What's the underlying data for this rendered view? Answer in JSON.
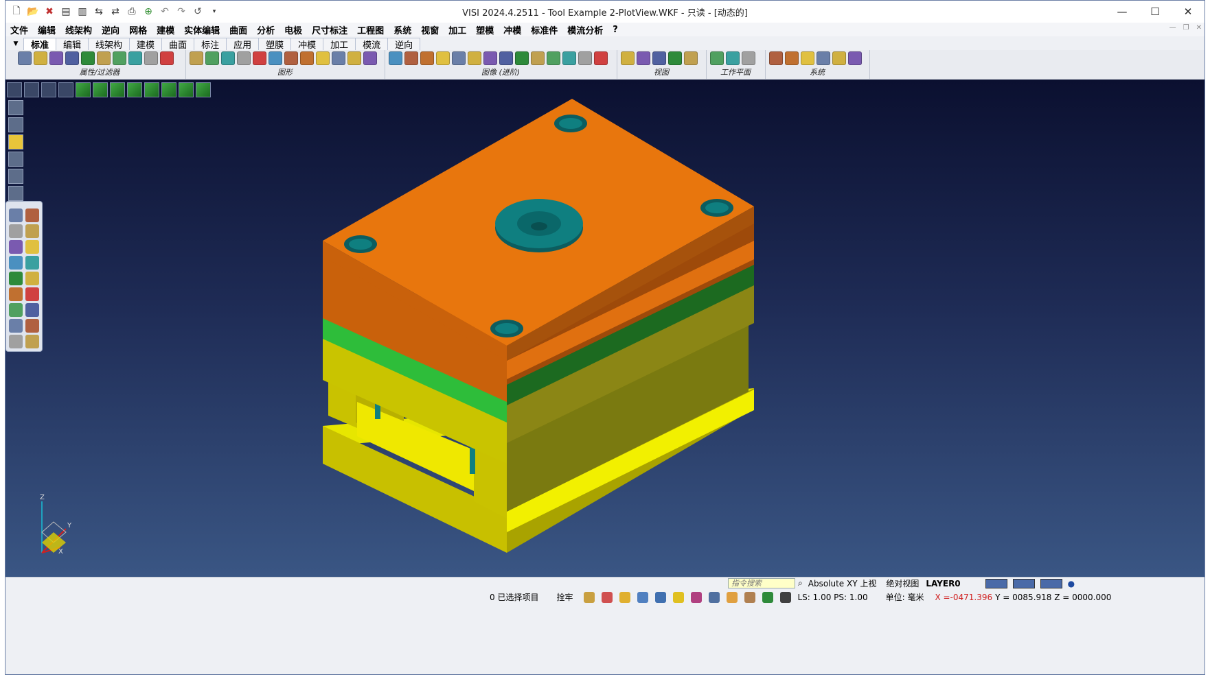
{
  "window": {
    "title": "VISI 2024.4.2511 - Tool Example 2-PlotView.WKF - 只读 - [动态的]",
    "controls": [
      "—",
      "☐",
      "✕"
    ]
  },
  "quick_access": [
    "new-file",
    "open-file",
    "save",
    "print-preview",
    "export",
    "import",
    "print",
    "zoom",
    "undo",
    "redo",
    "undo-list",
    "more"
  ],
  "menu": [
    "文件",
    "编辑",
    "线架构",
    "逆向",
    "网格",
    "建模",
    "实体编辑",
    "曲面",
    "分析",
    "电极",
    "尺寸标注",
    "工程图",
    "系统",
    "视窗",
    "加工",
    "塑模",
    "冲模",
    "标准件",
    "模流分析",
    "?"
  ],
  "tabs": [
    "标准",
    "编辑",
    "线架构",
    "建模",
    "曲面",
    "标注",
    "应用",
    "塑膜",
    "冲模",
    "加工",
    "模流",
    "逆向"
  ],
  "ribbon_groups": [
    {
      "label": "属性/过滤器",
      "count": 10
    },
    {
      "label": "图形",
      "count": 12
    },
    {
      "label": "图像 (进阶)",
      "count": 14
    },
    {
      "label": "视图",
      "count": 5
    },
    {
      "label": "工作平面",
      "count": 3
    },
    {
      "label": "系统",
      "count": 6
    }
  ],
  "axis": {
    "z": "Z",
    "y": "Y",
    "x": "X"
  },
  "status": {
    "search_placeholder": "指令搜索",
    "view": "Absolute XY 上视",
    "abs_view": "绝对视图",
    "layer": "LAYER0",
    "selected": "0 已选择项目",
    "lock": "拴牢",
    "ls_ps": "LS: 1.00 PS: 1.00",
    "unit": "单位: 毫米",
    "x_coord": "X =-0471.396",
    "yz_coord": "Y = 0085.918 Z = 0000.000"
  },
  "colors": {
    "plate_top": "#e07010",
    "plate_green": "#2ebd3a",
    "plate_yellow": "#d9d000",
    "accent_teal": "#0f7f80",
    "coord_red": "#d02020"
  }
}
